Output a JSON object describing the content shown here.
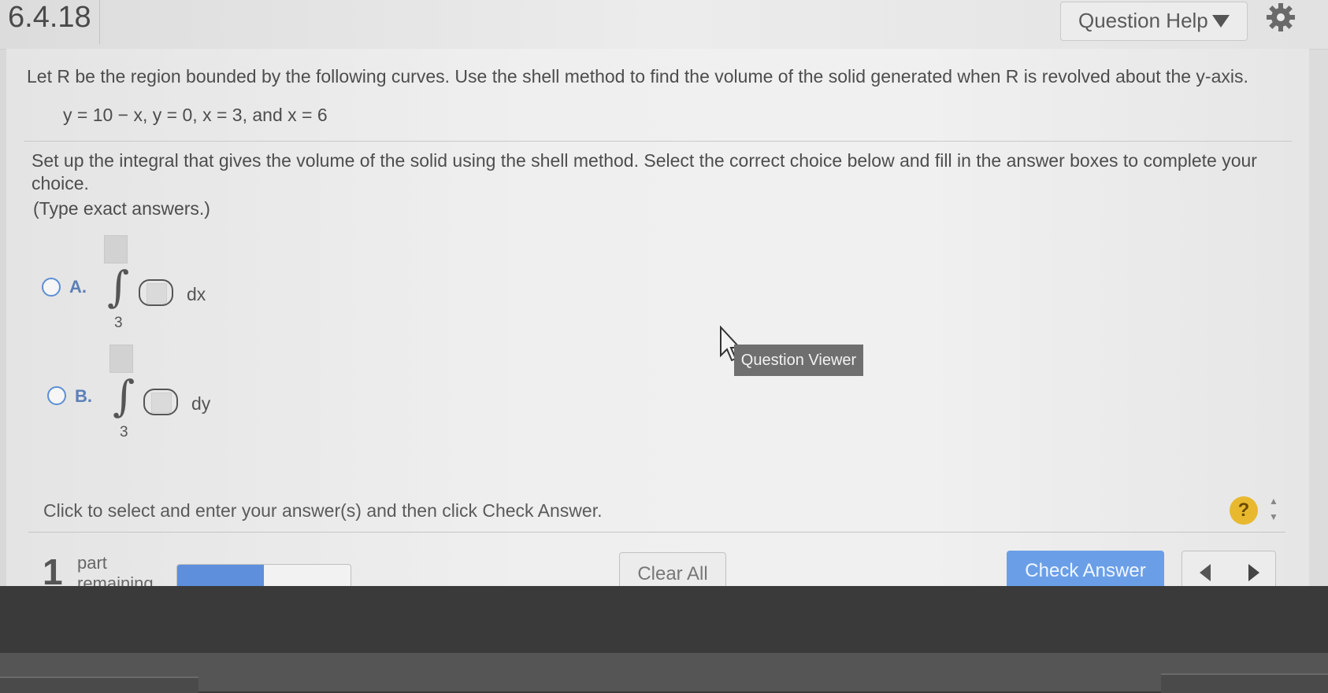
{
  "header": {
    "question_number": "6.4.18",
    "help_label": "Question Help"
  },
  "question": {
    "stem": "Let R be the region bounded by the following curves. Use the shell method to find the volume of the solid generated when R is revolved about the y-axis.",
    "curves": "y = 10 − x, y = 0, x = 3, and x = 6",
    "instruction": "Set up the integral that gives the volume of the solid using the shell method. Select the correct choice below and fill in the answer boxes to complete your choice.",
    "hint": "(Type exact answers.)",
    "choices": [
      {
        "label": "A.",
        "lower_limit": "3",
        "differential": "dx"
      },
      {
        "label": "B.",
        "lower_limit": "3",
        "differential": "dy"
      }
    ]
  },
  "tooltip": "Question Viewer",
  "footer": {
    "prompt": "Click to select and enter your answer(s) and then click Check Answer.",
    "help_symbol": "?",
    "parts_count": "1",
    "parts_label": "part remaining",
    "progress_fraction": 0.5,
    "clear_label": "Clear All",
    "check_label": "Check Answer"
  },
  "colors": {
    "accent": "#5b8fd6",
    "check_button": "#6a9fe8",
    "help_badge": "#e8b92f"
  }
}
